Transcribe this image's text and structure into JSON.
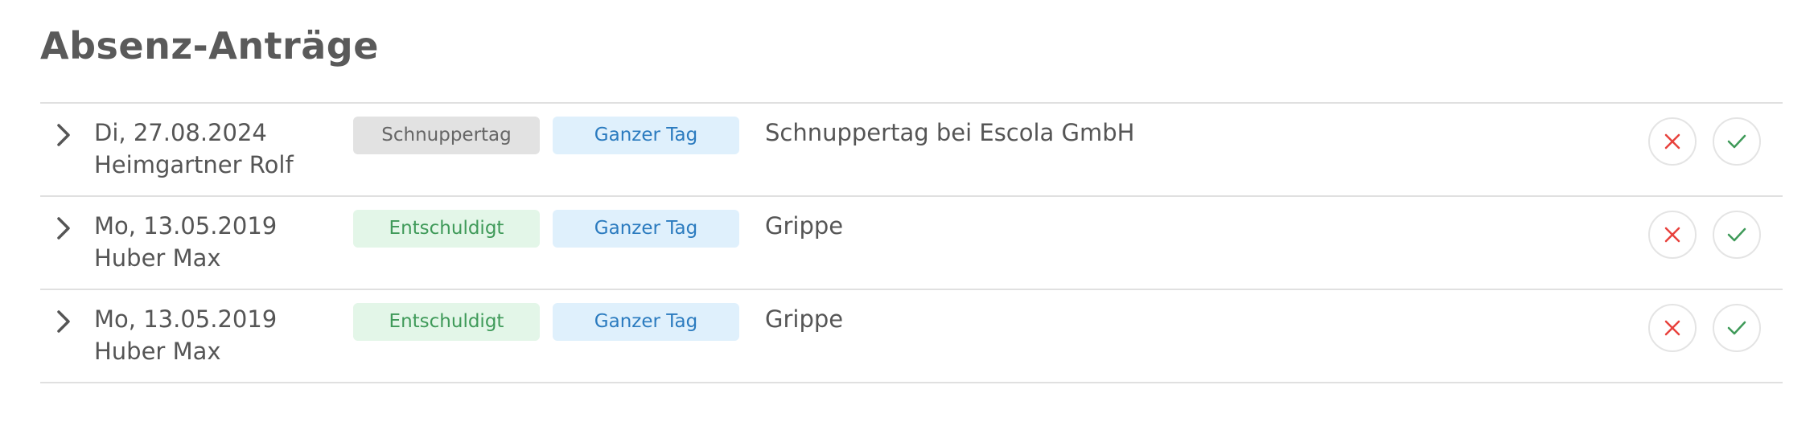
{
  "page": {
    "title": "Absenz-Anträge"
  },
  "requests": [
    {
      "date": "Di, 27.08.2024",
      "name": "Heimgartner Rolf",
      "type_badge": "Schnuppertag",
      "duration_badge": "Ganzer Tag",
      "comment": "Schnuppertag bei Escola GmbH"
    },
    {
      "date": "Mo, 13.05.2019",
      "name": "Huber Max",
      "type_badge": "Entschuldigt",
      "duration_badge": "Ganzer Tag",
      "comment": "Grippe"
    },
    {
      "date": "Mo, 13.05.2019",
      "name": "Huber Max",
      "type_badge": "Entschuldigt",
      "duration_badge": "Ganzer Tag",
      "comment": "Grippe"
    }
  ],
  "icons": {
    "expand": "chevron-right-icon",
    "reject": "close-icon",
    "accept": "check-icon"
  },
  "colors": {
    "reject": "#e8413c",
    "accept": "#3f9a59",
    "badge_neutral_bg": "#e2e2e2",
    "badge_excused_bg": "#e3f6e8",
    "badge_duration_bg": "#dff0fc",
    "badge_duration_text": "#2b7bbf"
  }
}
